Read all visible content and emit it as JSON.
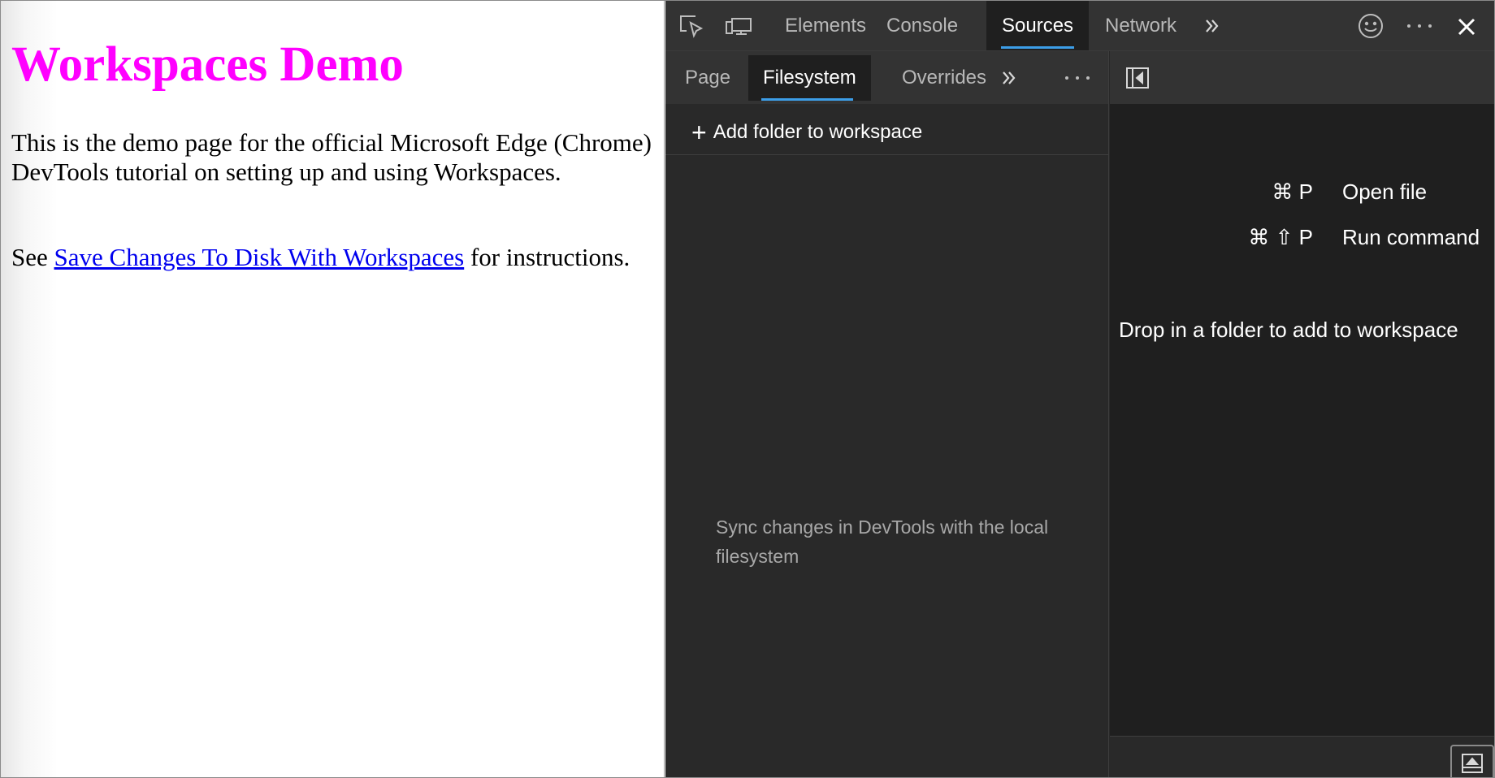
{
  "page": {
    "heading": "Workspaces Demo",
    "intro": "This is the demo page for the official Microsoft Edge (Chrome) DevTools tutorial on setting up and using Workspaces.",
    "see_prefix": "See ",
    "link_text": "Save Changes To Disk With Workspaces",
    "see_suffix": " for instructions."
  },
  "devtools": {
    "tabs": [
      {
        "label": "Elements"
      },
      {
        "label": "Console"
      },
      {
        "label": "Sources",
        "active": true
      },
      {
        "label": "Network"
      }
    ],
    "icons": {
      "inspect": "inspect-element-icon",
      "device": "device-toolbar-icon",
      "more_tabs": "chevron-double-right-icon",
      "feedback": "smiley-feedback-icon",
      "more": "more-horizontal-icon",
      "close": "close-icon"
    },
    "navigator": {
      "tabs": [
        {
          "label": "Page"
        },
        {
          "label": "Filesystem",
          "active": true
        },
        {
          "label": "Overrides"
        }
      ],
      "add_folder_label": "Add folder to workspace",
      "sync_message": "Sync changes in DevTools with the local filesystem"
    },
    "editor": {
      "shortcuts": [
        {
          "keys": "⌘ P",
          "action": "Open file"
        },
        {
          "keys": "⌘ ⇧ P",
          "action": "Run command"
        }
      ],
      "drop_message": "Drop in a folder to add to workspace"
    }
  },
  "colors": {
    "heading": "#ff00ff",
    "link": "#0000ee",
    "devtools_bg": "#292929",
    "toolbar_bg": "#333333",
    "active_tab_bg": "#1f1f1f",
    "accent": "#3c9ee8"
  }
}
